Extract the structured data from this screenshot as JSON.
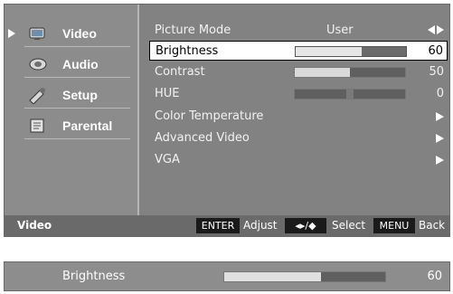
{
  "sidebar": {
    "items": [
      {
        "label": "Video",
        "icon": "video-icon"
      },
      {
        "label": "Audio",
        "icon": "audio-icon"
      },
      {
        "label": "Setup",
        "icon": "setup-icon"
      },
      {
        "label": "Parental",
        "icon": "parental-icon"
      }
    ],
    "active_index": 0
  },
  "menu": {
    "picture_mode": {
      "label": "Picture Mode",
      "value": "User"
    },
    "brightness": {
      "label": "Brightness",
      "value": "60",
      "level": 0.6
    },
    "contrast": {
      "label": "Contrast",
      "value": "50",
      "level": 0.5
    },
    "hue": {
      "label": "HUE",
      "value": "0",
      "level": 0.5
    },
    "color_temperature": {
      "label": "Color Temperature"
    },
    "advanced_video": {
      "label": "Advanced Video"
    },
    "vga": {
      "label": "VGA"
    }
  },
  "footer": {
    "title": "Video",
    "enter_key": "ENTER",
    "adjust_label": "Adjust",
    "nav_key": "◂▸/◆",
    "select_label": "Select",
    "menu_key": "MENU",
    "back_label": "Back"
  },
  "bottom_bar": {
    "label": "Brightness",
    "value": "60",
    "level": 0.6
  },
  "colors": {
    "panel": "#828282",
    "highlight": "#ffffff",
    "footer": "#6a6a6a",
    "key_bg": "#1a1a1a"
  }
}
